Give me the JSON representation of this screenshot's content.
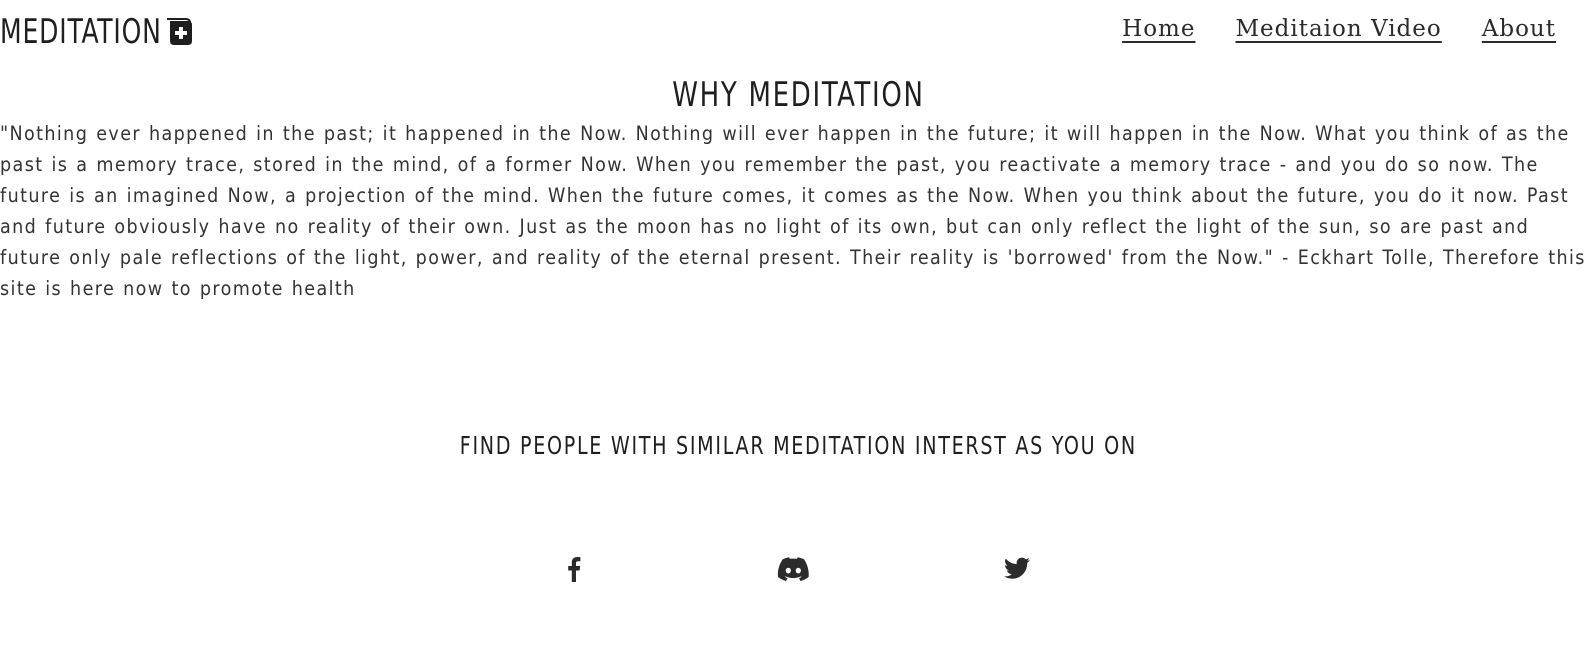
{
  "header": {
    "logo_text": "MEDITATION",
    "logo_icon": "medical-plus-icon",
    "nav": [
      {
        "label": "Home"
      },
      {
        "label": "Meditaion Video"
      },
      {
        "label": "About"
      }
    ]
  },
  "why": {
    "title": "WHY MEDITATION",
    "quote": "\"Nothing ever happened in the past; it happened in the Now. Nothing will ever happen in the future; it will happen in the Now. What you think of as the past is a memory trace, stored in the mind, of a former Now. When you remember the past, you reactivate a memory trace - and you do so now. The future is an imagined Now, a projection of the mind. When the future comes, it comes as the Now. When you think about the future, you do it now. Past and future obviously have no reality of their own. Just as the moon has no light of its own, but can only reflect the light of the sun, so are past and future only pale reflections of the light, power, and reality of the eternal present. Their reality is 'borrowed' from the Now.\" - Eckhart Tolle, Therefore this site is here now to promote health"
  },
  "find": {
    "title": "FIND PEOPLE WITH SIMILAR MEDITATION INTERST AS YOU ON"
  },
  "social": [
    {
      "icon": "facebook-icon"
    },
    {
      "icon": "discord-icon"
    },
    {
      "icon": "twitter-icon"
    }
  ],
  "colors": {
    "text": "#222222",
    "background": "#ffffff"
  }
}
